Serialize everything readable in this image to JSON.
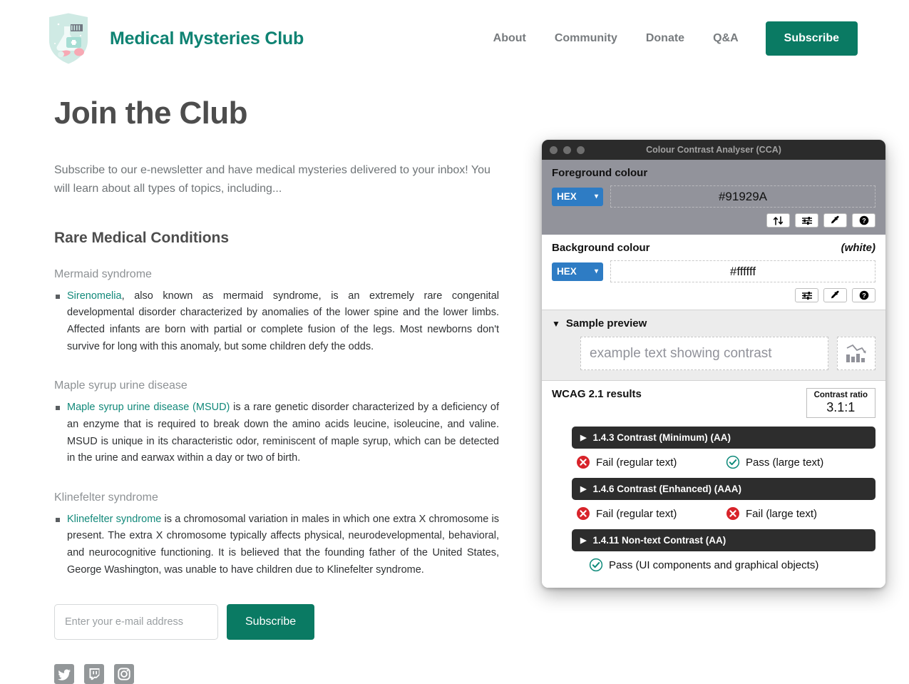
{
  "header": {
    "brand_name": "Medical Mysteries Club",
    "logo_alt": "shield-logo",
    "nav": [
      {
        "label": "About"
      },
      {
        "label": "Community"
      },
      {
        "label": "Donate"
      },
      {
        "label": "Q&A"
      }
    ],
    "subscribe_button": "Subscribe"
  },
  "main": {
    "page_title": "Join the Club",
    "lede": "Subscribe to our e-newsletter and have medical mysteries delivered to your inbox! You will learn about all types of topics, including...",
    "section_title": "Rare Medical Conditions",
    "conditions": [
      {
        "title": "Mermaid syndrome",
        "link_text": "Sirenomelia",
        "body": ", also known as mermaid syndrome, is an extremely rare congenital developmental disorder characterized by anomalies of the lower spine and the lower limbs. Affected infants are born with partial or complete fusion of the legs. Most newborns don't survive for long with this anomaly, but some children defy the odds."
      },
      {
        "title": "Maple syrup urine disease",
        "link_text": "Maple syrup urine disease (MSUD)",
        "body": " is a rare genetic disorder characterized by a deficiency of an enzyme that is required to break down the amino acids leucine, isoleucine, and valine. MSUD is unique in its characteristic odor, reminiscent of maple syrup, which can be detected in the urine and earwax within a day or two of birth."
      },
      {
        "title": "Klinefelter syndrome",
        "link_text": "Klinefelter syndrome",
        "body": " is a chromosomal variation in males in which one extra X chromosome is present. The extra X chromosome typically affects physical, neurodevelopmental, behavioral, and neurocognitive functioning. It is believed that the founding father of the United States, George Washington, was unable to have children due to Klinefelter syndrome."
      }
    ],
    "email_placeholder": "Enter your e-mail address",
    "email_value": "",
    "subscribe_button": "Subscribe",
    "social": [
      {
        "name": "twitter-icon"
      },
      {
        "name": "twitch-icon"
      },
      {
        "name": "instagram-icon"
      }
    ],
    "link_color": "#12897a",
    "brand_color": "#0a7a63"
  },
  "cca": {
    "window_title": "Colour Contrast Analyser (CCA)",
    "foreground": {
      "label": "Foreground colour",
      "format": "HEX",
      "value": "#91929A",
      "buttons": [
        "swap-colours-icon",
        "sliders-icon",
        "eyedropper-icon",
        "help-icon"
      ]
    },
    "background": {
      "label": "Background colour",
      "note": "(white)",
      "format": "HEX",
      "value": "#ffffff",
      "buttons": [
        "sliders-icon",
        "eyedropper-icon",
        "help-icon"
      ]
    },
    "sample_preview": {
      "label": "Sample preview",
      "text": "example text showing contrast",
      "chart_icon": "declining-bar-chart-icon"
    },
    "wcag": {
      "label": "WCAG 2.1 results",
      "ratio_label": "Contrast ratio",
      "ratio_value": "3.1:1",
      "criteria": [
        {
          "title": "1.4.3 Contrast (Minimum) (AA)",
          "results": [
            {
              "status": "fail",
              "text": "Fail (regular text)"
            },
            {
              "status": "pass",
              "text": "Pass (large text)"
            }
          ]
        },
        {
          "title": "1.4.6 Contrast (Enhanced) (AAA)",
          "results": [
            {
              "status": "fail",
              "text": "Fail (regular text)"
            },
            {
              "status": "fail",
              "text": "Fail (large text)"
            }
          ]
        },
        {
          "title": "1.4.11 Non-text Contrast (AA)",
          "results": [
            {
              "status": "pass",
              "text": "Pass (UI components and graphical objects)"
            }
          ]
        }
      ],
      "pass_color": "#0e8a7a",
      "fail_color": "#d8232a"
    }
  }
}
